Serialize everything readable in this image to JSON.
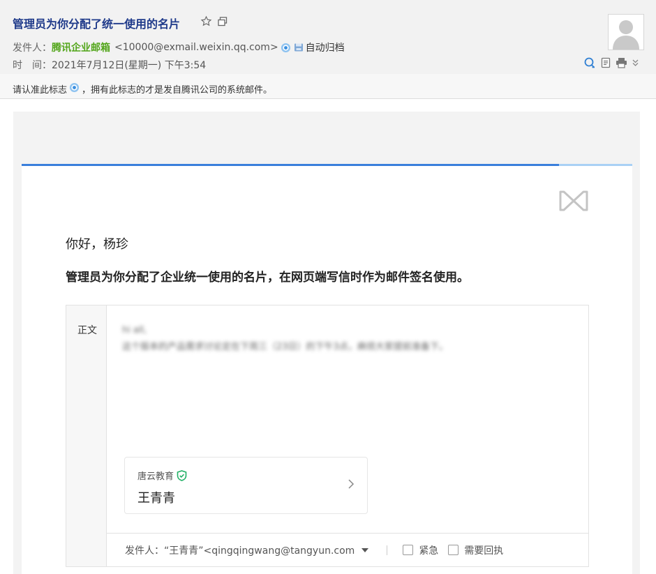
{
  "header": {
    "subject": "管理员为你分配了统一使用的名片",
    "sender_label": "发件人：",
    "sender_name": "腾讯企业邮箱",
    "sender_email": "<10000@exmail.weixin.qq.com>",
    "auto_archive": "自动归档",
    "time_label": "时　间：",
    "time_value": "2021年7月12日(星期一) 下午3:54"
  },
  "notice": {
    "before": "请认准此标志",
    "after": "，拥有此标志的才是发自腾讯公司的系统邮件。"
  },
  "body": {
    "greeting": "你好，杨珍",
    "lead": "管理员为你分配了企业统一使用的名片，在网页端写信时作为邮件签名使用。"
  },
  "preview": {
    "side_label": "正文",
    "blurred_lines": [
      "hi all,",
      "这个版本的产品需求讨论定在下周三（23日）的下午3点，麻烦大家提前准备下。"
    ],
    "card": {
      "company": "唐云教育",
      "person": "王青青"
    },
    "footer": {
      "from": "发件人：“王青青”<qingqingwang@tangyun.com",
      "urgent": "紧急",
      "receipt": "需要回执"
    }
  },
  "colors": {
    "accent": "#3a7fdb",
    "subject": "#1f3a8a",
    "sender": "#52a51a"
  }
}
